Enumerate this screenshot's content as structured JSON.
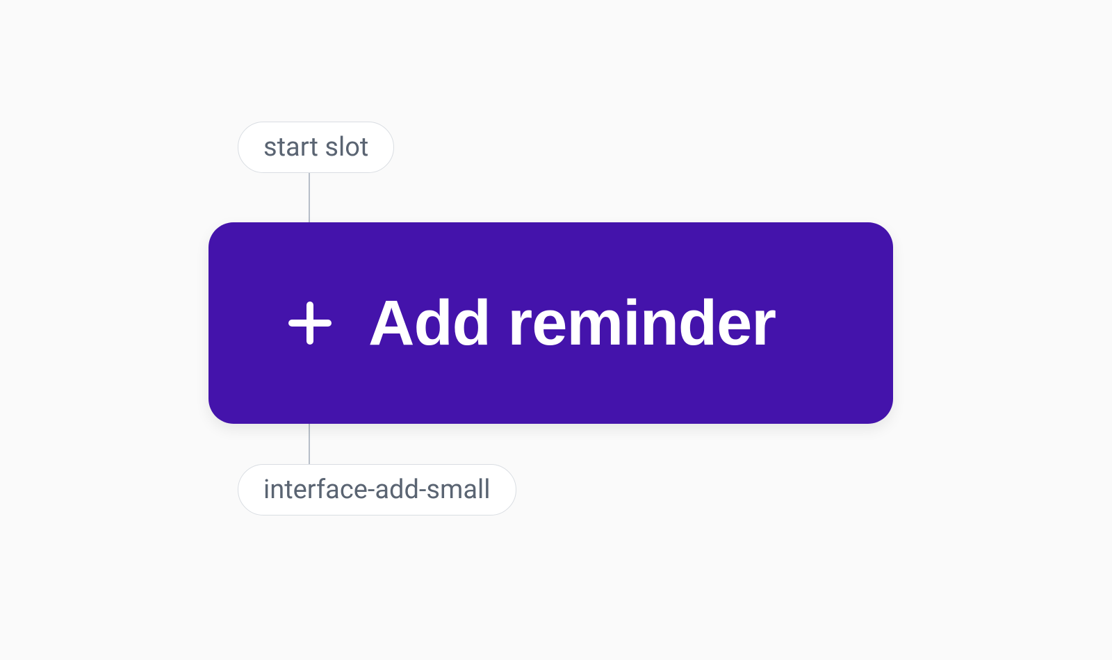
{
  "annotations": {
    "top_label": "start slot",
    "bottom_label": "interface-add-small"
  },
  "button": {
    "label": "Add reminder",
    "icon_name": "plus-icon"
  },
  "colors": {
    "brand_purple": "#4413ab",
    "pill_border": "#d9dde2",
    "pill_text": "#5a6472",
    "connector": "#b7bec8",
    "canvas_bg": "#fafafa"
  }
}
